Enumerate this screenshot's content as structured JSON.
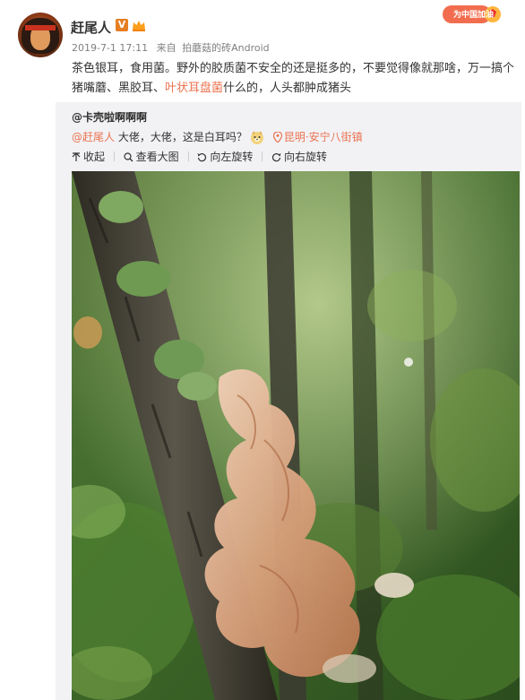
{
  "post": {
    "username": "赶尾人",
    "v_badge": "V",
    "meta": {
      "time": "2019-7-1 17:11",
      "source_prefix": "来自",
      "source": "拍蘑菇的砖Android"
    },
    "promo_text": "为中国加油",
    "content": {
      "part1": "茶色银耳，食用菌。野外的胶质菌不安全的还是挺多的，不要觉得像就那啥，万一搞个猪嘴蘑、黑胶耳、",
      "link": "叶状耳盘菌",
      "part2": "什么的，人头都肿成猪头"
    }
  },
  "repost": {
    "original_user": "@卡壳啦啊啊啊",
    "mention": "@赶尾人",
    "text": " 大佬，大佬，这是白耳吗？",
    "location": "昆明·安宁八街镇"
  },
  "toolbar": {
    "collapse": "收起",
    "view_large": "查看大图",
    "rotate_left": "向左旋转",
    "rotate_right": "向右旋转"
  },
  "icons": {
    "verified": "v-badge-icon",
    "member": "member-crown-icon",
    "doge": "doge-emoji-icon",
    "location": "location-pin-icon",
    "collapse": "arrow-up-icon",
    "search": "magnifier-icon",
    "rotate_left": "rotate-left-icon",
    "rotate_right": "rotate-right-icon"
  },
  "colors": {
    "link": "#eb7350",
    "repost_bg": "#f2f2f5",
    "meta_text": "#808080",
    "v_badge": "#e67e22"
  }
}
